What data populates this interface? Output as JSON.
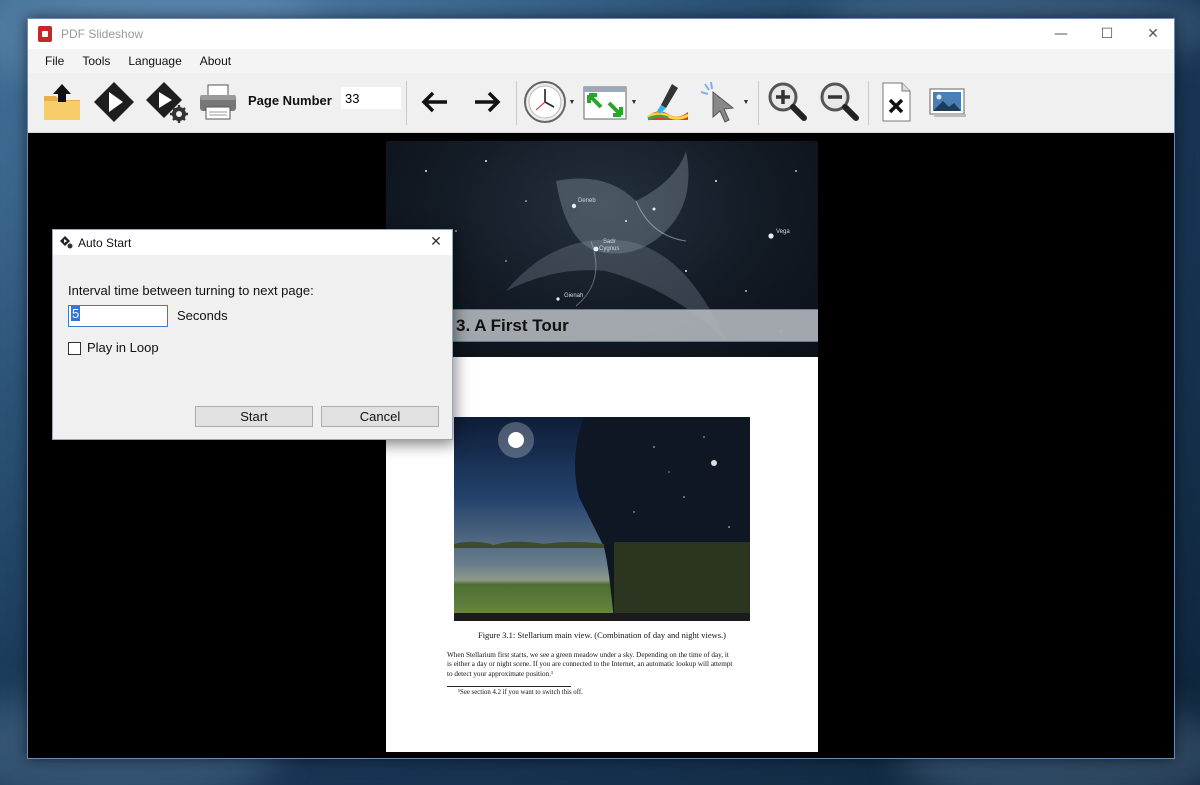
{
  "window": {
    "title": "PDF Slideshow",
    "controls": {
      "minimize": "—",
      "maximize": "☐",
      "close": "✕"
    }
  },
  "menu": {
    "items": [
      "File",
      "Tools",
      "Language",
      "About"
    ]
  },
  "toolbar": {
    "page_number_label": "Page Number",
    "page_number_value": "33",
    "icons": [
      "open-folder-icon",
      "play-icon",
      "play-settings-icon",
      "print-icon",
      "arrow-left-icon",
      "arrow-right-icon",
      "clock-icon",
      "fit-screen-icon",
      "color-brush-icon",
      "pointer-icon",
      "zoom-in-icon",
      "zoom-out-icon",
      "close-document-icon",
      "picture-icon"
    ]
  },
  "document": {
    "chapter_title": "3. A First Tour",
    "star_labels": [
      "Deneb",
      "Sadr",
      "Cygnus",
      "Vega",
      "Gienah"
    ],
    "figure_caption": "Figure 3.1: Stellarium main view. (Combination of day and night views.)",
    "paragraph_lines": [
      "When Stellarium first starts, we see a green meadow under a sky. Depending on the time of day, it",
      "is either a day or night scene. If you are connected to the Internet, an automatic lookup will attempt",
      "to detect your approximate position.¹"
    ],
    "footnote": "¹See section 4.2 if you want to switch this off."
  },
  "dialog": {
    "title": "Auto Start",
    "interval_label": "Interval time between turning to next page:",
    "interval_value": "5",
    "seconds_label": "Seconds",
    "loop_label": "Play in Loop",
    "loop_checked": false,
    "start_label": "Start",
    "cancel_label": "Cancel"
  }
}
